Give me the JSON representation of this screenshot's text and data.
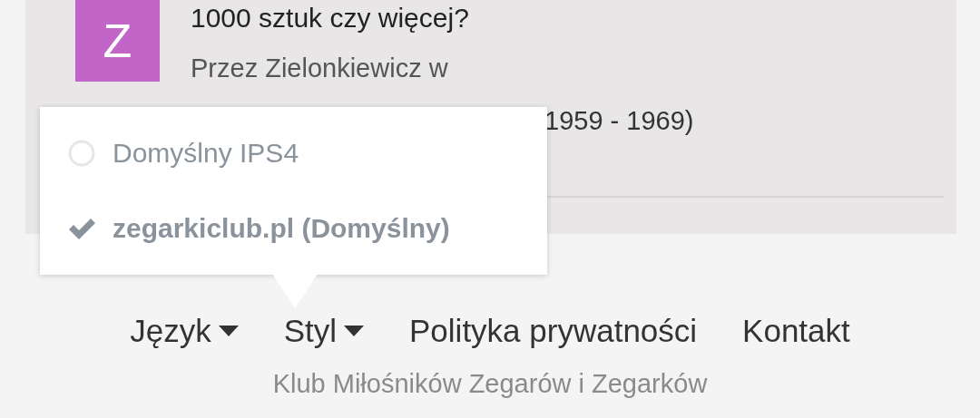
{
  "topic": {
    "avatar": {
      "letter": "Z",
      "color": "#c165c9"
    },
    "title": "1000 sztuk czy więcej?",
    "byline": "Przez Zielonkiewicz w",
    "meta": "1959 - 1969)"
  },
  "style_menu": {
    "items": [
      {
        "label": "Domyślny IPS4",
        "selected": false
      },
      {
        "label": "zegarkiclub.pl (Domyślny)",
        "selected": true
      }
    ]
  },
  "footer": {
    "links": [
      {
        "label": "Język",
        "dropdown": true
      },
      {
        "label": "Styl",
        "dropdown": true
      },
      {
        "label": "Polityka prywatności",
        "dropdown": false
      },
      {
        "label": "Kontakt",
        "dropdown": false
      }
    ],
    "tagline": "Klub Miłośników Zegarów i Zegarków"
  }
}
